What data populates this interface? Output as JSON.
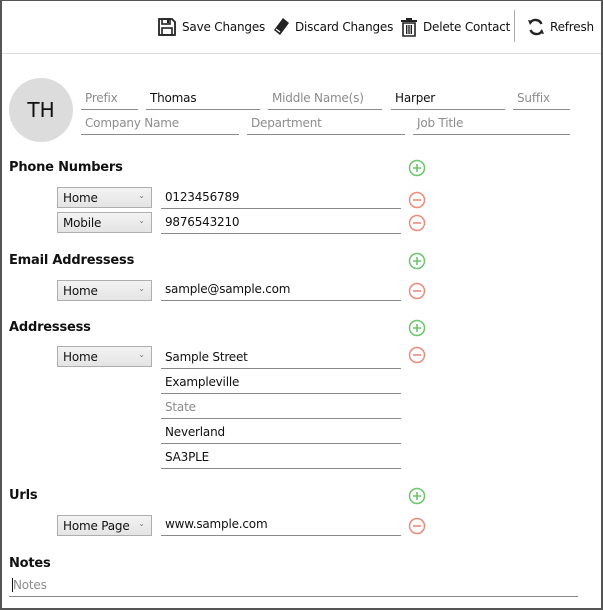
{
  "toolbar": {
    "save_label": "Save Changes",
    "discard_label": "Discard Changes",
    "delete_label": "Delete Contact",
    "refresh_label": "Refresh",
    "icons": {
      "save": "floppy-disk-icon",
      "discard": "eraser-icon",
      "delete": "trash-icon",
      "refresh": "refresh-icon"
    }
  },
  "contact": {
    "initials": "TH",
    "prefix": {
      "value": "",
      "placeholder": "Prefix"
    },
    "first_name": {
      "value": "Thomas",
      "placeholder": ""
    },
    "middle_name": {
      "value": "",
      "placeholder": "Middle Name(s)"
    },
    "last_name": {
      "value": "Harper",
      "placeholder": ""
    },
    "suffix": {
      "value": "",
      "placeholder": "Suffix"
    },
    "company": {
      "value": "",
      "placeholder": "Company Name"
    },
    "department": {
      "value": "",
      "placeholder": "Department"
    },
    "job_title": {
      "value": "",
      "placeholder": "Job Title"
    }
  },
  "phones": {
    "title": "Phone Numbers",
    "items": [
      {
        "type": "Home",
        "value": "0123456789"
      },
      {
        "type": "Mobile",
        "value": "9876543210"
      }
    ]
  },
  "emails": {
    "title": "Email Addressess",
    "items": [
      {
        "type": "Home",
        "value": "sample@sample.com"
      }
    ]
  },
  "addresses": {
    "title": "Addressess",
    "items": [
      {
        "type": "Home",
        "street": "Sample Street",
        "city": "Exampleville",
        "state": "",
        "state_placeholder": "State",
        "country": "Neverland",
        "postcode": "SA3PLE"
      }
    ]
  },
  "urls": {
    "title": "Urls",
    "items": [
      {
        "type": "Home Page",
        "value": "www.sample.com"
      }
    ]
  },
  "notes": {
    "title": "Notes",
    "value": "",
    "placeholder": "Notes"
  },
  "colors": {
    "add": "#6cc46c",
    "remove": "#ef8a7a",
    "avatar_bg": "#dcdcdc"
  }
}
